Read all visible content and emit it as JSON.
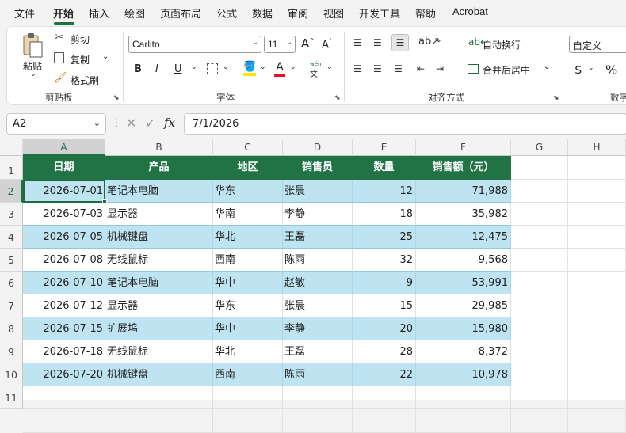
{
  "menu": {
    "tabs": [
      "文件",
      "开始",
      "插入",
      "绘图",
      "页面布局",
      "公式",
      "数据",
      "审阅",
      "视图",
      "开发工具",
      "帮助",
      "Acrobat"
    ],
    "active": "开始"
  },
  "ribbon": {
    "clipboard": {
      "paste": "粘贴",
      "cut": "剪切",
      "copy": "复制",
      "format_painter": "格式刷",
      "label": "剪贴板"
    },
    "font": {
      "name": "Carlito",
      "size": "11",
      "increase": "A",
      "decrease": "A",
      "bold": "B",
      "italic": "I",
      "underline": "U",
      "fill_letter": "",
      "font_letter": "A",
      "phonetic": "wén",
      "label": "字体"
    },
    "alignment": {
      "wrap": "自动换行",
      "merge": "合并后居中",
      "label": "对齐方式"
    },
    "number": {
      "format": "自定义",
      "currency": "$",
      "percent": "%",
      "label": "数字"
    }
  },
  "formula_bar": {
    "name_box": "A2",
    "fx": "fx",
    "formula": "7/1/2026"
  },
  "sheet": {
    "columns": [
      "A",
      "B",
      "C",
      "D",
      "E",
      "F",
      "G",
      "H"
    ],
    "rows": [
      "1",
      "2",
      "3",
      "4",
      "5",
      "6",
      "7",
      "8",
      "9",
      "10",
      "11"
    ],
    "header": [
      "日期",
      "产品",
      "地区",
      "销售员",
      "数量",
      "销售额（元）"
    ],
    "data": [
      [
        "2026-07-01",
        "笔记本电脑",
        "华东",
        "张晨",
        "12",
        "71,988"
      ],
      [
        "2026-07-03",
        "显示器",
        "华南",
        "李静",
        "18",
        "35,982"
      ],
      [
        "2026-07-05",
        "机械键盘",
        "华北",
        "王磊",
        "25",
        "12,475"
      ],
      [
        "2026-07-08",
        "无线鼠标",
        "西南",
        "陈雨",
        "32",
        "9,568"
      ],
      [
        "2026-07-10",
        "笔记本电脑",
        "华中",
        "赵敏",
        "9",
        "53,991"
      ],
      [
        "2026-07-12",
        "显示器",
        "华东",
        "张晨",
        "15",
        "29,985"
      ],
      [
        "2026-07-15",
        "扩展坞",
        "华中",
        "李静",
        "20",
        "15,980"
      ],
      [
        "2026-07-18",
        "无线鼠标",
        "华北",
        "王磊",
        "28",
        "8,372"
      ],
      [
        "2026-07-20",
        "机械键盘",
        "西南",
        "陈雨",
        "22",
        "10,978"
      ]
    ]
  },
  "colors": {
    "accent": "#217346",
    "band": "#bee3f1",
    "selection": "#1e6b40"
  }
}
